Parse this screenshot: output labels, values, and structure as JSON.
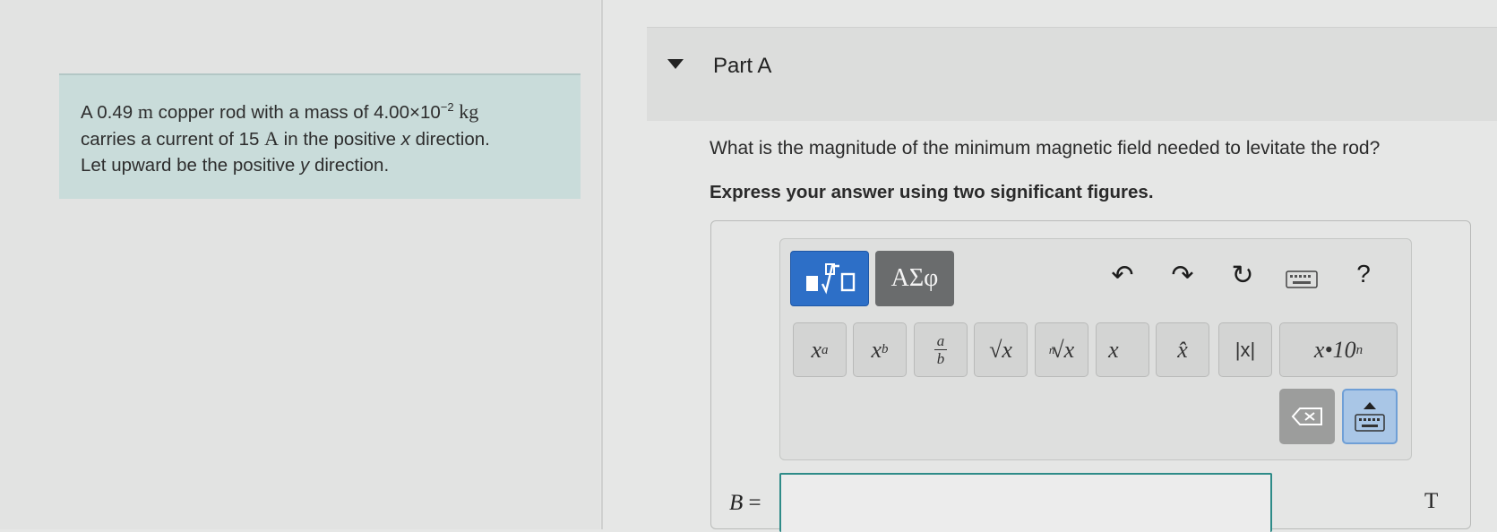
{
  "problem": {
    "text_a": "A 0.49 ",
    "unit_m": "m",
    "text_b": " copper rod with a mass of 4.00×10",
    "exp": "−2",
    "unit_kg": "kg",
    "line2_a": "carries a current of 15 ",
    "unit_A": "A",
    "line2_b": " in the positive ",
    "x_var": "x",
    "line2_c": " direction.",
    "line3_a": "Let upward be the positive ",
    "y_var": "y",
    "line3_b": " direction."
  },
  "part": {
    "title": "Part A"
  },
  "question": "What is the magnitude of the minimum magnetic field needed to levitate the rod?",
  "instruction": "Express your answer using two significant figures.",
  "toolbar": {
    "greek_label": "ΑΣφ",
    "undo": "↶",
    "redo": "↷",
    "reset": "↻",
    "help": "?"
  },
  "keys": {
    "superscript": {
      "base": "x",
      "sup": "a"
    },
    "subscript": {
      "base": "x",
      "sub": "b"
    },
    "fraction": {
      "num": "a",
      "den": "b"
    },
    "sqrt": "√x",
    "nthroot": {
      "index": "n",
      "body": "√x"
    },
    "vector": "x⃗",
    "unit_vector": "x̂",
    "abs": "|x|",
    "sci": {
      "base": "x•10",
      "sup": "n"
    }
  },
  "answer": {
    "variable": "B",
    "equals": " =",
    "value": "",
    "unit": "T"
  }
}
